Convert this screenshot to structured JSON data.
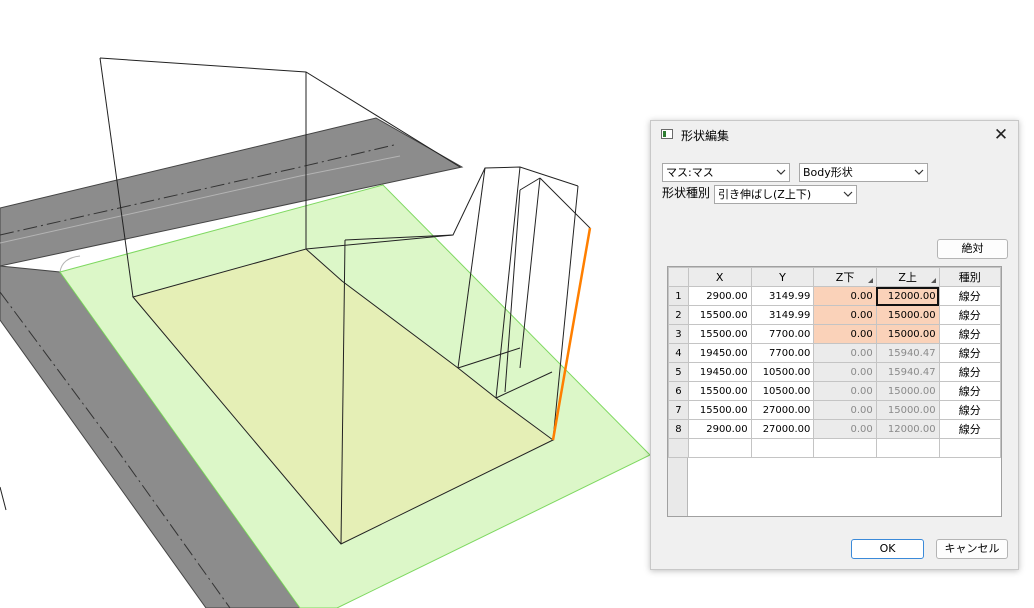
{
  "dialog": {
    "title": "形状編集",
    "close_glyph": "✕",
    "mass_select": "マス:マス",
    "body_select": "Body形状",
    "shape_type_label": "形状種別",
    "shape_type_select": "引き伸ばし(Z上下)",
    "absolute_button": "絶対",
    "ok_button": "OK",
    "cancel_button": "キャンセル",
    "table": {
      "headers": [
        "X",
        "Y",
        "Z下",
        "Z上",
        "種別"
      ],
      "rows": [
        {
          "n": "1",
          "x": "2900.00",
          "y": "3149.99",
          "zl": "0.00",
          "zu": "12000.00",
          "kind": "線分"
        },
        {
          "n": "2",
          "x": "15500.00",
          "y": "3149.99",
          "zl": "0.00",
          "zu": "15000.00",
          "kind": "線分"
        },
        {
          "n": "3",
          "x": "15500.00",
          "y": "7700.00",
          "zl": "0.00",
          "zu": "15000.00",
          "kind": "線分"
        },
        {
          "n": "4",
          "x": "19450.00",
          "y": "7700.00",
          "zl": "0.00",
          "zu": "15940.47",
          "kind": "線分"
        },
        {
          "n": "5",
          "x": "19450.00",
          "y": "10500.00",
          "zl": "0.00",
          "zu": "15940.47",
          "kind": "線分"
        },
        {
          "n": "6",
          "x": "15500.00",
          "y": "10500.00",
          "zl": "0.00",
          "zu": "15000.00",
          "kind": "線分"
        },
        {
          "n": "7",
          "x": "15500.00",
          "y": "27000.00",
          "zl": "0.00",
          "zu": "15000.00",
          "kind": "線分"
        },
        {
          "n": "8",
          "x": "2900.00",
          "y": "27000.00",
          "zl": "0.00",
          "zu": "12000.00",
          "kind": "線分"
        }
      ]
    }
  },
  "colors": {
    "road": "#8c8c8c",
    "site_green": "#dcf7c8",
    "footprint_yellow": "#e6edb4",
    "highlight_edge": "#ff7f00",
    "editable_cell": "#fad2b9"
  }
}
